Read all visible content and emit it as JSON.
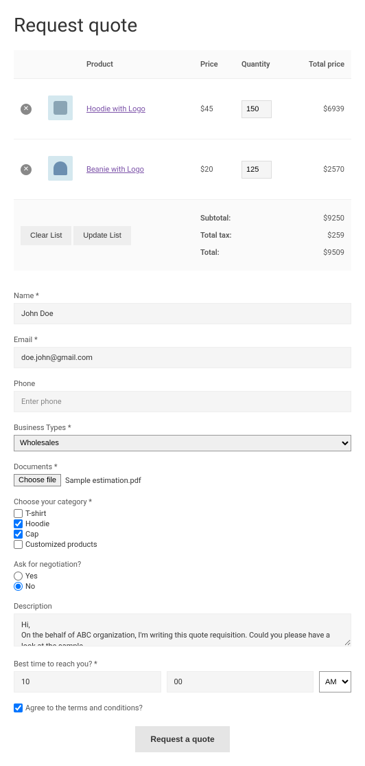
{
  "title": "Request quote",
  "table": {
    "headers": {
      "product": "Product",
      "price": "Price",
      "quantity": "Quantity",
      "total": "Total price"
    },
    "rows": [
      {
        "name": "Hoodie with Logo",
        "price": "$45",
        "qty": "150",
        "total": "$6939"
      },
      {
        "name": "Beanie with Logo",
        "price": "$20",
        "qty": "125",
        "total": "$2570"
      }
    ],
    "clear": "Clear List",
    "update": "Update List",
    "totals": {
      "subtotal_label": "Subtotal:",
      "subtotal": "$9250",
      "tax_label": "Total tax:",
      "tax": "$259",
      "total_label": "Total:",
      "total": "$9509"
    }
  },
  "form": {
    "name_label": "Name *",
    "name_value": "John Doe",
    "email_label": "Email *",
    "email_value": "doe.john@gmail.com",
    "phone_label": "Phone",
    "phone_placeholder": "Enter phone",
    "biztype_label": "Business Types *",
    "biztype_value": "Wholesales",
    "docs_label": "Documents *",
    "choose_file": "Choose file",
    "file_name": "Sample estimation.pdf",
    "category_label": "Choose your category *",
    "categories": {
      "tshirt": "T-shirt",
      "hoodie": "Hoodie",
      "cap": "Cap",
      "custom": "Customized products"
    },
    "negotiation_label": "Ask for negotiation?",
    "yes": "Yes",
    "no": "No",
    "desc_label": "Description",
    "desc_value": "Hi,\nOn the behalf of ABC organization, I'm writing this quote requisition. Could you please have a look at the sample",
    "time_label": "Best time to reach you? *",
    "time_hour": "10",
    "time_min": "00",
    "time_ampm": "AM",
    "agree": "Agree to the terms and conditions?",
    "submit": "Request a quote"
  }
}
